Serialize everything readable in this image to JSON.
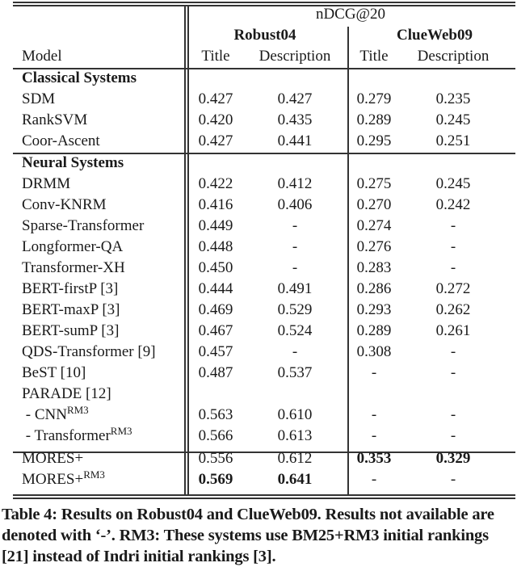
{
  "table": {
    "metric_header": "nDCG@20",
    "dataset_headers": [
      "Robust04",
      "ClueWeb09"
    ],
    "column_headers": [
      "Model",
      "Title",
      "Description",
      "Title",
      "Description"
    ],
    "sections": [
      {
        "label": "Classical Systems",
        "rows": [
          {
            "model": "SDM",
            "sup": "",
            "values": [
              "0.427",
              "0.427",
              "0.279",
              "0.235"
            ],
            "bold": [
              false,
              false,
              false,
              false
            ]
          },
          {
            "model": "RankSVM",
            "sup": "",
            "values": [
              "0.420",
              "0.435",
              "0.289",
              "0.245"
            ],
            "bold": [
              false,
              false,
              false,
              false
            ]
          },
          {
            "model": "Coor-Ascent",
            "sup": "",
            "values": [
              "0.427",
              "0.441",
              "0.295",
              "0.251"
            ],
            "bold": [
              false,
              false,
              false,
              false
            ]
          }
        ]
      },
      {
        "label": "Neural Systems",
        "rows": [
          {
            "model": "DRMM",
            "sup": "",
            "values": [
              "0.422",
              "0.412",
              "0.275",
              "0.245"
            ],
            "bold": [
              false,
              false,
              false,
              false
            ]
          },
          {
            "model": "Conv-KNRM",
            "sup": "",
            "values": [
              "0.416",
              "0.406",
              "0.270",
              "0.242"
            ],
            "bold": [
              false,
              false,
              false,
              false
            ]
          },
          {
            "model": "Sparse-Transformer",
            "sup": "",
            "values": [
              "0.449",
              "-",
              "0.274",
              "-"
            ],
            "bold": [
              false,
              false,
              false,
              false
            ]
          },
          {
            "model": "Longformer-QA",
            "sup": "",
            "values": [
              "0.448",
              "-",
              "0.276",
              "-"
            ],
            "bold": [
              false,
              false,
              false,
              false
            ]
          },
          {
            "model": "Transformer-XH",
            "sup": "",
            "values": [
              "0.450",
              "-",
              "0.283",
              "-"
            ],
            "bold": [
              false,
              false,
              false,
              false
            ]
          },
          {
            "model": "BERT-firstP [3]",
            "sup": "",
            "values": [
              "0.444",
              "0.491",
              "0.286",
              "0.272"
            ],
            "bold": [
              false,
              false,
              false,
              false
            ]
          },
          {
            "model": "BERT-maxP [3]",
            "sup": "",
            "values": [
              "0.469",
              "0.529",
              "0.293",
              "0.262"
            ],
            "bold": [
              false,
              false,
              false,
              false
            ]
          },
          {
            "model": "BERT-sumP [3]",
            "sup": "",
            "values": [
              "0.467",
              "0.524",
              "0.289",
              "0.261"
            ],
            "bold": [
              false,
              false,
              false,
              false
            ]
          },
          {
            "model": "QDS-Transformer [9]",
            "sup": "",
            "values": [
              "0.457",
              "-",
              "0.308",
              "-"
            ],
            "bold": [
              false,
              false,
              false,
              false
            ]
          },
          {
            "model": "BeST [10]",
            "sup": "",
            "values": [
              "0.487",
              "0.537",
              "-",
              "-"
            ],
            "bold": [
              false,
              false,
              false,
              false
            ]
          },
          {
            "model": "PARADE [12]",
            "sup": "",
            "values": [
              "",
              "",
              "",
              ""
            ],
            "bold": [
              false,
              false,
              false,
              false
            ]
          },
          {
            "model": " - CNN",
            "sup": "RM3",
            "values": [
              "0.563",
              "0.610",
              "-",
              "-"
            ],
            "bold": [
              false,
              false,
              false,
              false
            ]
          },
          {
            "model": " - Transformer",
            "sup": "RM3",
            "values": [
              "0.566",
              "0.613",
              "-",
              "-"
            ],
            "bold": [
              false,
              false,
              false,
              false
            ]
          }
        ]
      },
      {
        "label": "",
        "rows": [
          {
            "model": "MORES+",
            "sup": "",
            "values": [
              "0.556",
              "0.612",
              "0.353",
              "0.329"
            ],
            "bold": [
              false,
              false,
              true,
              true
            ]
          },
          {
            "model": "MORES+",
            "sup": "RM3",
            "values": [
              "0.569",
              "0.641",
              "-",
              "-"
            ],
            "bold": [
              true,
              true,
              false,
              false
            ]
          }
        ]
      }
    ]
  },
  "caption": "Table 4: Results on Robust04 and ClueWeb09. Results not available are denoted with ‘-’. RM3: These systems use BM25+RM3 initial rankings [21] instead of Indri initial rankings [3]."
}
